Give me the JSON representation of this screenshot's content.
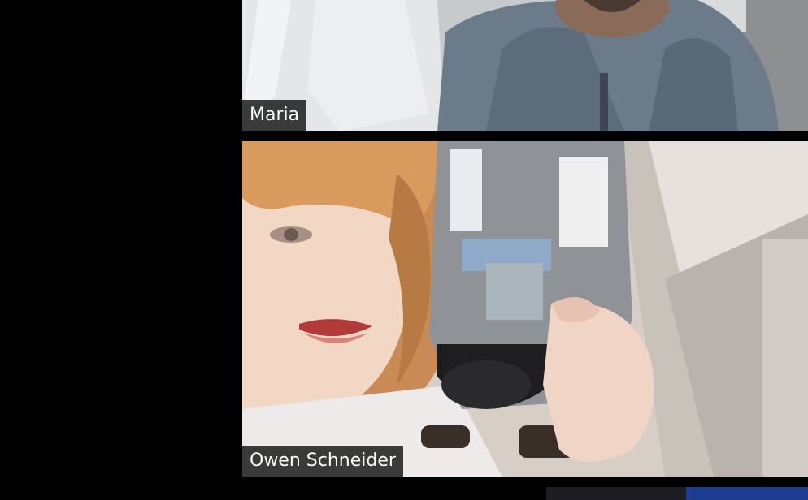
{
  "participants": [
    {
      "name": "Maria"
    },
    {
      "name": "Owen Schneider"
    }
  ]
}
